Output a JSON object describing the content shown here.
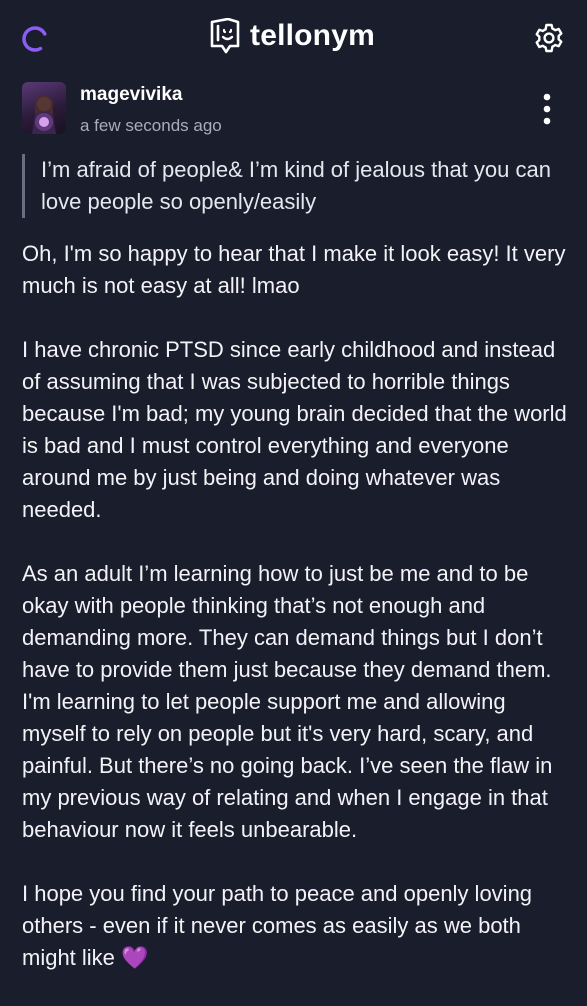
{
  "header": {
    "app_name": "tellonym",
    "loading_icon": "spinner-icon",
    "logo_icon": "tellonym-logo-icon",
    "settings_icon": "gear-icon",
    "accent_color": "#8b5cf6"
  },
  "post": {
    "username": "magevivika",
    "timestamp": "a few seconds ago",
    "menu_icon": "more-vertical-icon",
    "question": "I’m afraid of people& I’m kind of jealous that you can love people so openly/easily",
    "answer_paragraphs": [
      "Oh, I'm so happy to hear that I make it look easy! It very much is not easy at all! lmao",
      "I have chronic PTSD since early childhood and instead of assuming that I was subjected to horrible things because I'm bad; my young brain decided that the world is bad and I must control everything and everyone around me by just being and doing whatever was needed.",
      "As an adult I’m learning how to just be me and to be okay with people thinking that’s not enough and demanding more. They can demand things but I don’t have to provide them just because they demand them. I'm learning to let people support me and allowing myself to rely on people but it's very hard, scary, and painful. But there’s no going back. I’ve seen the flaw in my previous way of relating and when I engage in that behaviour now it feels unbearable.",
      "I hope you find your path to peace and openly loving others - even if it never comes as easily as we both might like"
    ],
    "emoji": "💜"
  }
}
